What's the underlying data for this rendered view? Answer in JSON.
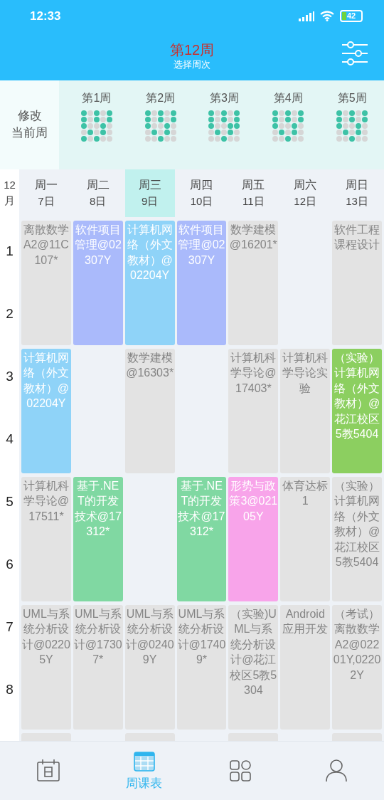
{
  "status_bar": {
    "time": "12:33",
    "battery": "42"
  },
  "header": {
    "title": "第12周",
    "subtitle": "选择周次"
  },
  "week_picker": {
    "modify_lines": [
      "修改",
      "当前周"
    ],
    "weeks": [
      {
        "label": "第1周",
        "dots": [
          [
            true,
            false,
            true,
            false,
            true
          ],
          [
            true,
            false,
            true,
            false,
            true
          ],
          [
            true,
            false,
            false,
            true,
            false
          ],
          [
            false,
            true,
            false,
            true,
            false
          ],
          [
            true,
            false,
            true,
            false,
            false
          ]
        ]
      },
      {
        "label": "第2周",
        "dots": [
          [
            true,
            false,
            true,
            false,
            true
          ],
          [
            true,
            false,
            true,
            false,
            true
          ],
          [
            true,
            false,
            false,
            true,
            false
          ],
          [
            false,
            true,
            false,
            true,
            false
          ],
          [
            false,
            false,
            true,
            false,
            false
          ]
        ]
      },
      {
        "label": "第3周",
        "dots": [
          [
            true,
            false,
            true,
            false,
            true
          ],
          [
            true,
            false,
            true,
            false,
            true
          ],
          [
            true,
            false,
            false,
            true,
            true
          ],
          [
            false,
            true,
            false,
            true,
            false
          ],
          [
            false,
            false,
            true,
            false,
            false
          ]
        ]
      },
      {
        "label": "第4周",
        "dots": [
          [
            true,
            false,
            true,
            false,
            true
          ],
          [
            true,
            false,
            true,
            false,
            true
          ],
          [
            true,
            false,
            false,
            true,
            false
          ],
          [
            false,
            true,
            false,
            true,
            false
          ],
          [
            false,
            false,
            true,
            false,
            false
          ]
        ]
      },
      {
        "label": "第5周",
        "dots": [
          [
            true,
            false,
            true,
            false,
            true
          ],
          [
            true,
            false,
            true,
            false,
            true
          ],
          [
            true,
            false,
            false,
            true,
            false
          ],
          [
            false,
            true,
            false,
            true,
            false
          ],
          [
            false,
            false,
            true,
            false,
            false
          ]
        ]
      }
    ]
  },
  "month": "12\n月",
  "periods": [
    "1",
    "2",
    "3",
    "4",
    "5",
    "6",
    "7",
    "8"
  ],
  "days": [
    {
      "name": "周一",
      "date": "7日",
      "selected": false,
      "slots": [
        {
          "kind": "course",
          "text": "离散数学A2@11C107*",
          "color": "#e3e3e3"
        },
        {
          "kind": "course",
          "text": "计算机网络（外文教材）@02204Y",
          "color": "#8fd3f8"
        },
        {
          "kind": "course",
          "text": "计算机科学导论@17511*",
          "color": "#e3e3e3"
        },
        {
          "kind": "course",
          "text": "UML与系统分析设计@02205Y",
          "color": "#e3e3e3"
        },
        {
          "kind": "partial",
          "color": "#e3e3e3"
        }
      ]
    },
    {
      "name": "周二",
      "date": "8日",
      "selected": false,
      "slots": [
        {
          "kind": "course",
          "text": "软件项目管理@02307Y",
          "color": "#aabafb"
        },
        {
          "kind": "empty"
        },
        {
          "kind": "course",
          "text": "基于.NET的开发技术@17312*",
          "color": "#80d8a2"
        },
        {
          "kind": "course",
          "text": "UML与系统分析设计@17307*",
          "color": "#e3e3e3"
        },
        {
          "kind": "empty"
        }
      ]
    },
    {
      "name": "周三",
      "date": "9日",
      "selected": true,
      "slots": [
        {
          "kind": "course",
          "text": "计算机网络（外文教材）@02204Y",
          "color": "#8fd3f8"
        },
        {
          "kind": "course",
          "text": "数学建模@16303*",
          "color": "#e3e3e3"
        },
        {
          "kind": "empty"
        },
        {
          "kind": "course",
          "text": "UML与系统分析设计@02409Y",
          "color": "#e3e3e3"
        },
        {
          "kind": "partial",
          "color": "#e3e3e3"
        }
      ]
    },
    {
      "name": "周四",
      "date": "10日",
      "selected": false,
      "slots": [
        {
          "kind": "course",
          "text": "软件项目管理@02307Y",
          "color": "#aabafb"
        },
        {
          "kind": "empty"
        },
        {
          "kind": "course",
          "text": "基于.NET的开发技术@17312*",
          "color": "#80d8a2"
        },
        {
          "kind": "course",
          "text": "UML与系统分析设计@17409*",
          "color": "#e3e3e3"
        },
        {
          "kind": "empty"
        }
      ]
    },
    {
      "name": "周五",
      "date": "11日",
      "selected": false,
      "slots": [
        {
          "kind": "course",
          "text": "数学建模@16201*",
          "color": "#e3e3e3"
        },
        {
          "kind": "course",
          "text": "计算机科学导论@17403*",
          "color": "#e3e3e3"
        },
        {
          "kind": "course",
          "text": "形势与政策3@02105Y",
          "color": "#f8a4ea"
        },
        {
          "kind": "course",
          "text": "（实验)UML与系统分析设计@花江校区5教5304",
          "color": "#e3e3e3"
        },
        {
          "kind": "partial",
          "color": "#e3e3e3"
        }
      ]
    },
    {
      "name": "周六",
      "date": "12日",
      "selected": false,
      "slots": [
        {
          "kind": "empty"
        },
        {
          "kind": "course",
          "text": "计算机科学导论实验",
          "color": "#e3e3e3"
        },
        {
          "kind": "course",
          "text": "体育达标1",
          "color": "#e3e3e3"
        },
        {
          "kind": "course",
          "text": "Android应用开发",
          "color": "#e3e3e3"
        },
        {
          "kind": "empty"
        }
      ]
    },
    {
      "name": "周日",
      "date": "13日",
      "selected": false,
      "slots": [
        {
          "kind": "course",
          "text": "软件工程课程设计",
          "color": "#e3e3e3"
        },
        {
          "kind": "course",
          "text": "（实验）计算机网络（外文教材）@花江校区5教5404",
          "color": "#8ccf60"
        },
        {
          "kind": "course",
          "text": "（实验）计算机网络（外文教材）@花江校区5教5404",
          "color": "#e3e3e3"
        },
        {
          "kind": "course",
          "text": "（考试）离散数学A2@02201Y,02202Y",
          "color": "#e3e3e3"
        },
        {
          "kind": "partial",
          "color": "#e3e3e3"
        }
      ]
    }
  ],
  "bottom_nav": [
    {
      "kind": "calendar",
      "selected": false
    },
    {
      "kind": "timetable",
      "label": "周课表",
      "selected": true
    },
    {
      "kind": "apps",
      "selected": false
    },
    {
      "kind": "profile",
      "selected": false
    }
  ]
}
